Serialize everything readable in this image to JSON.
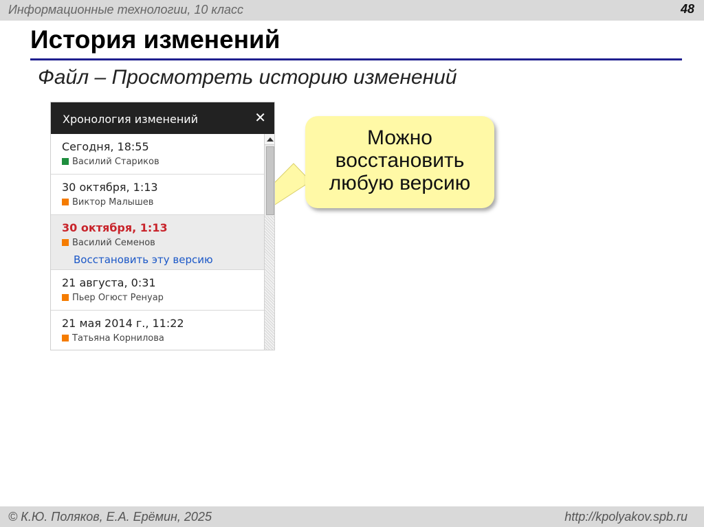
{
  "header": {
    "course_title": "Информационные технологии, 10 класс",
    "slide_number": "48"
  },
  "slide": {
    "title": "История изменений",
    "menu_path": "Файл – Просмотреть историю изменений"
  },
  "history_panel": {
    "title": "Хронология изменений",
    "close_icon": "close-icon",
    "items": [
      {
        "date": "Сегодня, 18:55",
        "author": "Василий Стариков",
        "color": "#1e8e3e",
        "selected": false
      },
      {
        "date": "30 октября, 1:13",
        "author": "Виктор Малышев",
        "color": "#f57c00",
        "selected": false
      },
      {
        "date": "30 октября, 1:13",
        "author": "Василий Семенов",
        "color": "#f57c00",
        "selected": true,
        "restore_link": "Восстановить эту версию"
      },
      {
        "date": "21 августа, 0:31",
        "author": "Пьер Огюст Ренуар",
        "color": "#f57c00",
        "selected": false
      },
      {
        "date": "21 мая 2014 г., 11:22",
        "author": "Татьяна Корнилова",
        "color": "#f57c00",
        "selected": false
      }
    ]
  },
  "callout": {
    "lines": [
      "Можно",
      "восстановить",
      "любую версию"
    ]
  },
  "footer": {
    "authors": "© К.Ю. Поляков, Е.А. Ерёмин, 2025",
    "url": "http://kpolyakov.spb.ru"
  },
  "colors": {
    "accent_rule": "#1f1f8f",
    "selected_date": "#c8242b",
    "link": "#1a57c7",
    "callout_bg": "#fff9a6"
  }
}
